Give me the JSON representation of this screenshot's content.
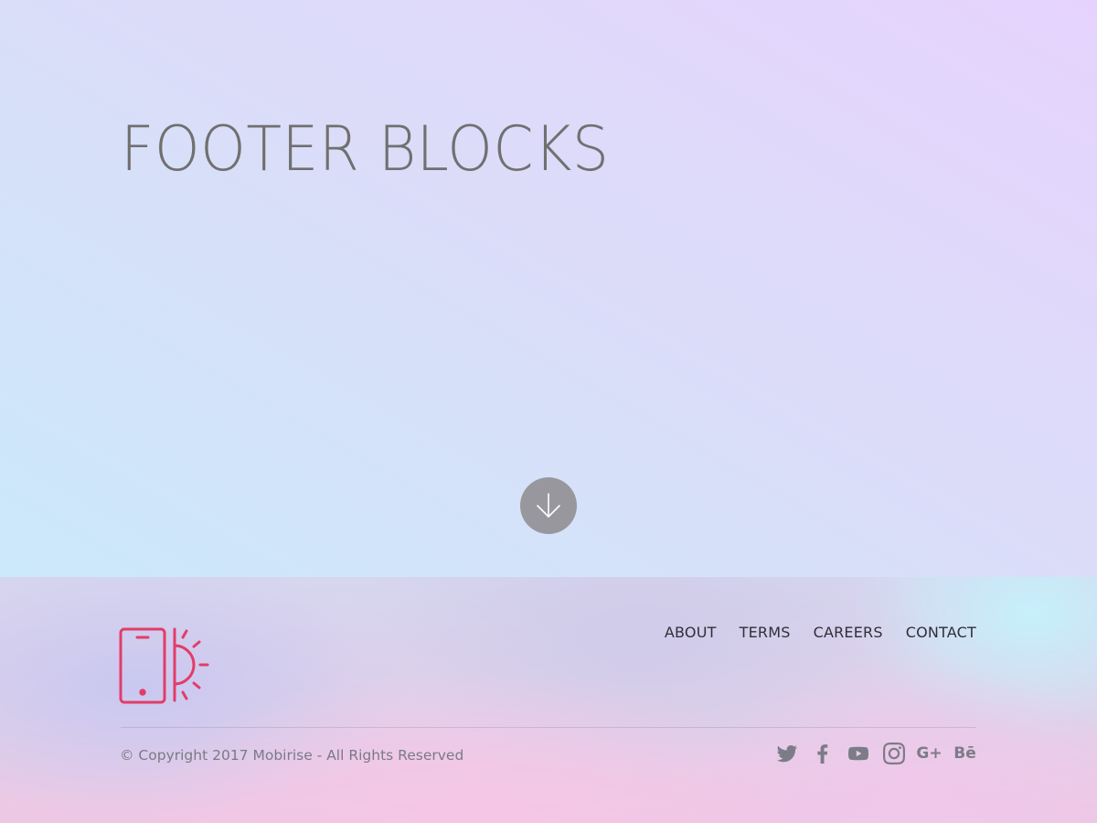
{
  "hero": {
    "title": "FOOTER BLOCKS",
    "scroll_icon": "arrow-down-icon"
  },
  "footer": {
    "logo_icon": "phone-sun-logo-icon",
    "nav": [
      {
        "label": "ABOUT"
      },
      {
        "label": "TERMS"
      },
      {
        "label": "CAREERS"
      },
      {
        "label": "CONTACT"
      }
    ],
    "copyright": "© Copyright 2017 Mobirise - All Rights Reserved",
    "social": [
      {
        "icon": "twitter-icon"
      },
      {
        "icon": "facebook-icon"
      },
      {
        "icon": "youtube-icon"
      },
      {
        "icon": "instagram-icon"
      },
      {
        "icon": "google-plus-icon",
        "text": "G+"
      },
      {
        "icon": "behance-icon",
        "text": "Bē"
      }
    ]
  },
  "colors": {
    "accent": "#e23d6a",
    "title": "#707070",
    "scroll_button": "#97979d"
  }
}
